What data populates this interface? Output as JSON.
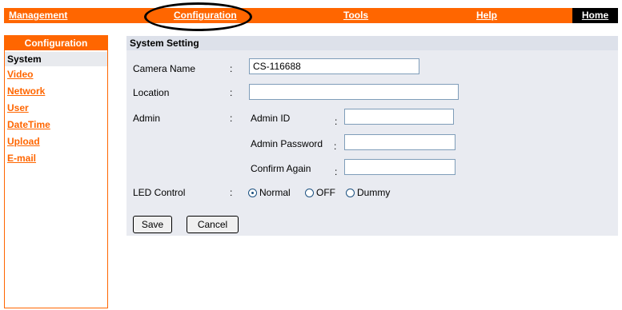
{
  "topnav": {
    "management": "Management",
    "configuration": "Configuration",
    "tools": "Tools",
    "help": "Help",
    "home": "Home"
  },
  "sidebar": {
    "title": "Configuration",
    "items": [
      {
        "label": "System"
      },
      {
        "label": "Video"
      },
      {
        "label": "Network"
      },
      {
        "label": "User"
      },
      {
        "label": "DateTime"
      },
      {
        "label": "Upload"
      },
      {
        "label": "E-mail"
      }
    ]
  },
  "panel": {
    "title": "System Setting",
    "camera_name": {
      "label": "Camera Name",
      "value": "CS-116688"
    },
    "location": {
      "label": "Location",
      "value": ""
    },
    "admin": {
      "label": "Admin",
      "admin_id": {
        "label": "Admin ID",
        "value": ""
      },
      "admin_password": {
        "label": "Admin Password",
        "value": ""
      },
      "confirm_again": {
        "label": "Confirm Again",
        "value": ""
      }
    },
    "led_control": {
      "label": "LED Control",
      "options": [
        "Normal",
        "OFF",
        "Dummy"
      ],
      "selected": "Normal"
    },
    "save_label": "Save",
    "cancel_label": "Cancel"
  },
  "colon": ":",
  "colors": {
    "accent": "#ff6600",
    "panel_bg": "#e9ebf1"
  }
}
